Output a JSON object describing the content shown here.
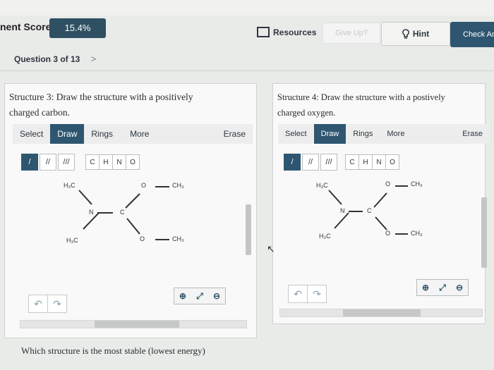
{
  "header": {
    "score_label": "nent Score:",
    "score_value": "15.4%",
    "resources_label": "Resources",
    "giveup_label": "Give Up?",
    "hint_label": "Hint",
    "check_label": "Check An"
  },
  "question_nav": {
    "label": "Question 3 of 13",
    "next_icon": "chevron-right-icon"
  },
  "structure3": {
    "prompt_line1": "Structure 3: Draw the structure with a positively",
    "prompt_line2": "charged carbon.",
    "tabs": [
      "Select",
      "Draw",
      "Rings",
      "More"
    ],
    "active_tab": "Draw",
    "erase": "Erase",
    "elements": [
      "C",
      "H",
      "N",
      "O"
    ],
    "atoms": {
      "h3c_top": "H₃C",
      "o_top": "O",
      "ch3_top": "CH₃",
      "n": "N",
      "c": "C",
      "h3c_bot": "H₃C",
      "o_bot": "O",
      "ch3_bot": "CH₃"
    }
  },
  "structure4": {
    "prompt_line1": "Structure 4: Draw the structure with a postively",
    "prompt_line2": "charged oxygen.",
    "tabs": [
      "Select",
      "Draw",
      "Rings",
      "More"
    ],
    "active_tab": "Draw",
    "erase": "Erase",
    "elements": [
      "C",
      "H",
      "N",
      "O"
    ],
    "atoms": {
      "h3c_top": "H₃C",
      "o_top": "O",
      "ch3_top": "CH₃",
      "n": "N",
      "c": "C",
      "h3c_bot": "H₃C",
      "o_bot": "O",
      "ch3_bot": "CH₃"
    }
  },
  "bottom_question": "Which structure is the most stable (lowest energy)",
  "colors": {
    "accent": "#2f5670",
    "score_badge": "#2f4f63"
  }
}
